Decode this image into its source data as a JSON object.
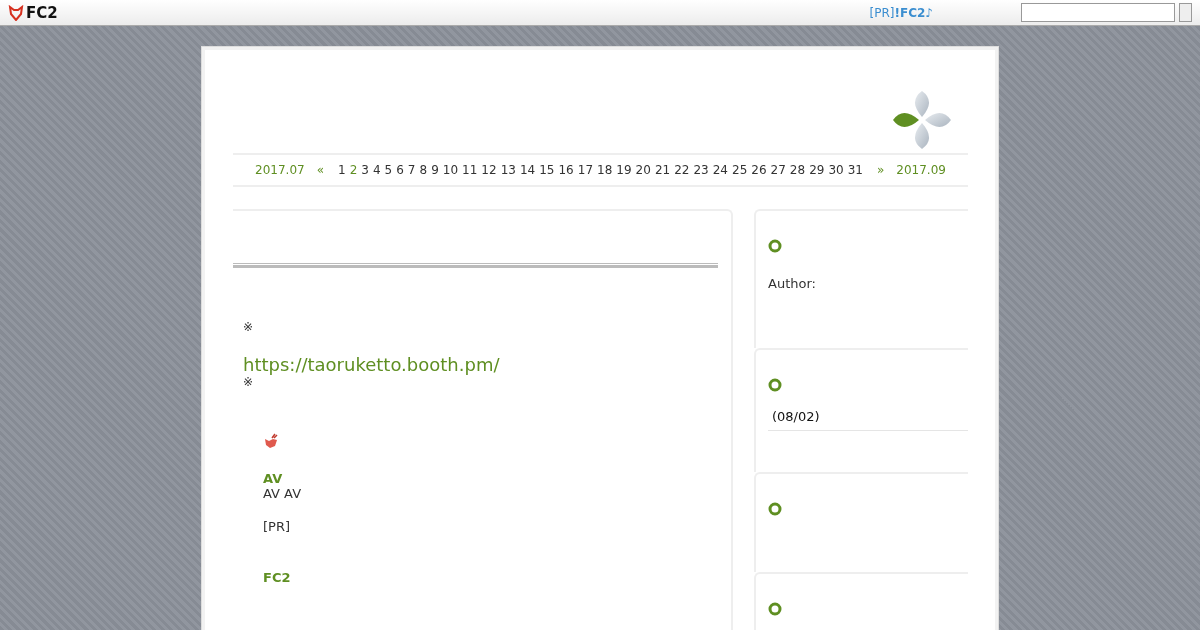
{
  "topbar": {
    "logo": "FC2",
    "pr_prefix": "[PR]",
    "pr_link": "!FC2",
    "pr_suffix": "♪"
  },
  "calendar": {
    "prev": "2017.07",
    "prev_arrow": "«",
    "next_arrow": "»",
    "next": "2017.09",
    "days": [
      {
        "label": "1",
        "linked": false
      },
      {
        "label": "2",
        "linked": true
      },
      {
        "label": "3",
        "linked": false
      },
      {
        "label": "4",
        "linked": false
      },
      {
        "label": "5",
        "linked": false
      },
      {
        "label": "6",
        "linked": false
      },
      {
        "label": "7",
        "linked": false
      },
      {
        "label": "8",
        "linked": false
      },
      {
        "label": "9",
        "linked": false
      },
      {
        "label": "10",
        "linked": false
      },
      {
        "label": "11",
        "linked": false
      },
      {
        "label": "12",
        "linked": false
      },
      {
        "label": "13",
        "linked": false
      },
      {
        "label": "14",
        "linked": false
      },
      {
        "label": "15",
        "linked": false
      },
      {
        "label": "16",
        "linked": false
      },
      {
        "label": "17",
        "linked": false
      },
      {
        "label": "18",
        "linked": false
      },
      {
        "label": "19",
        "linked": false
      },
      {
        "label": "20",
        "linked": false
      },
      {
        "label": "21",
        "linked": false
      },
      {
        "label": "22",
        "linked": false
      },
      {
        "label": "23",
        "linked": false
      },
      {
        "label": "24",
        "linked": false
      },
      {
        "label": "25",
        "linked": false
      },
      {
        "label": "26",
        "linked": false
      },
      {
        "label": "27",
        "linked": false
      },
      {
        "label": "28",
        "linked": false
      },
      {
        "label": "29",
        "linked": false
      },
      {
        "label": "30",
        "linked": false
      },
      {
        "label": "31",
        "linked": false
      }
    ]
  },
  "entry": {
    "note_top": "※",
    "url": "https://taoruketto.booth.pm/",
    "note_bottom": "※",
    "ad": {
      "title": "AV",
      "text": "AV AV",
      "pr": "[PR]",
      "footer_title": "FC2"
    }
  },
  "sidebar": [
    {
      "kind": "profile",
      "text": "Author:"
    },
    {
      "kind": "entries",
      "text": "(08/02)"
    },
    {
      "kind": "empty"
    },
    {
      "kind": "empty"
    }
  ]
}
